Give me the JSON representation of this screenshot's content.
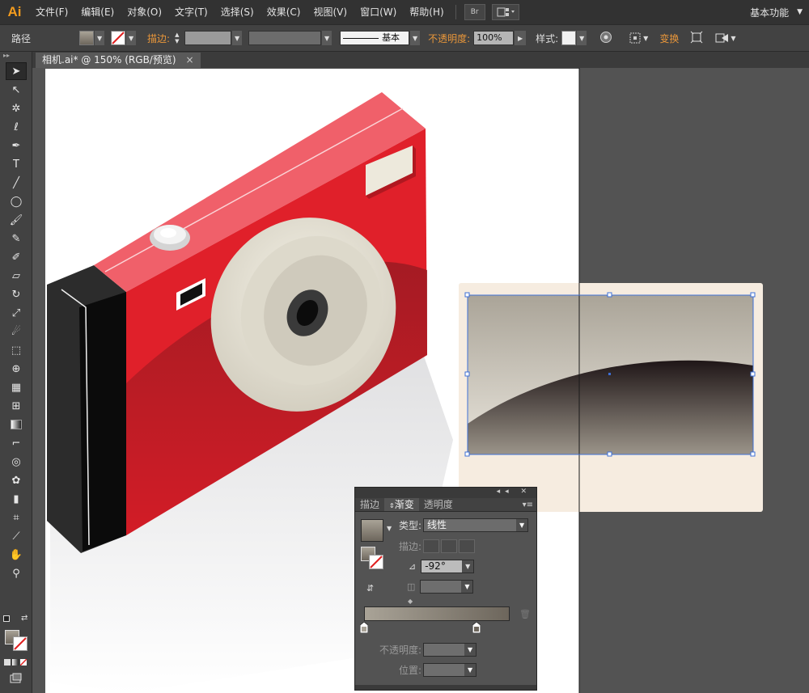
{
  "app": {
    "logo": "Ai",
    "workspace": "基本功能"
  },
  "menu": [
    "文件(F)",
    "编辑(E)",
    "对象(O)",
    "文字(T)",
    "选择(S)",
    "效果(C)",
    "视图(V)",
    "窗口(W)",
    "帮助(H)"
  ],
  "menubar_buttons": {
    "bridge": "Br"
  },
  "control_bar": {
    "object_type": "路径",
    "stroke_label": "描边:",
    "stroke_style": "基本",
    "opacity_label": "不透明度:",
    "opacity_value": "100%",
    "style_label": "样式:",
    "transform_label": "变换"
  },
  "document_tab": {
    "title": "相机.ai* @ 150% (RGB/预览)",
    "close": "×"
  },
  "gradient_panel": {
    "tabs": [
      "描边",
      "渐变",
      "透明度"
    ],
    "type_label": "类型:",
    "type_value": "线性",
    "stroke_label": "描边:",
    "angle_value": "-92°",
    "opacity_label": "不透明度:",
    "location_label": "位置:"
  },
  "colors": {
    "camera_red": "#e0202a",
    "camera_red_light": "#f0606a",
    "camera_dark": "#1e1e1e",
    "lens_cream": "#ede9dc",
    "artboard_bg": "#ffffff",
    "panel_bg": "#535353",
    "gradient_start": "#a9a397",
    "gradient_end": "#221819",
    "selection_bg": "#f6ece0",
    "accent_orange": "#e8963a",
    "selection_blue": "#3d6fd6"
  },
  "tools": [
    "selection-icon",
    "direct-selection-icon",
    "magic-wand-icon",
    "lasso-icon",
    "pen-icon",
    "type-icon",
    "line-icon",
    "ellipse-icon",
    "paintbrush-icon",
    "pencil-icon",
    "blob-brush-icon",
    "eraser-icon",
    "rotate-icon",
    "scale-icon",
    "warp-icon",
    "free-transform-icon",
    "shape-builder-icon",
    "graph-icon",
    "mesh-icon",
    "gradient-icon",
    "eyedropper-icon",
    "blend-icon",
    "symbol-sprayer-icon",
    "column-graph-icon",
    "artboard-icon",
    "slice-icon",
    "hand-icon",
    "zoom-icon"
  ]
}
